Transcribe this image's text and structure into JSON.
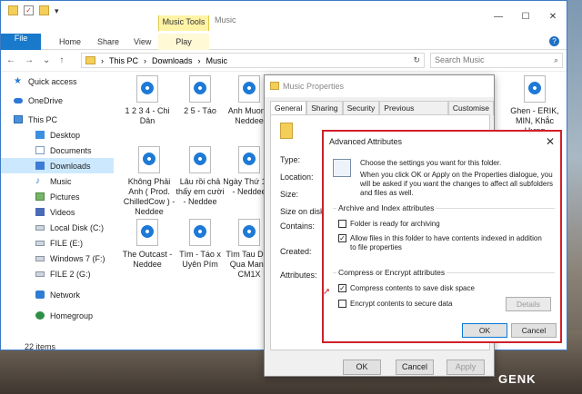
{
  "window": {
    "contextual_tab": "Music Tools",
    "title": "Music",
    "controls": {
      "minimize": "—",
      "maximize": "☐",
      "close": "✕"
    }
  },
  "ribbon": {
    "tabs": [
      "File",
      "Home",
      "Share",
      "View",
      "Play"
    ]
  },
  "address": {
    "path": [
      "This PC",
      "Downloads",
      "Music"
    ],
    "search_placeholder": "Search Music"
  },
  "sidebar": {
    "items": [
      {
        "label": "Quick access",
        "icon": "star-icon"
      },
      {
        "label": "OneDrive",
        "icon": "cloud-icon"
      },
      {
        "label": "This PC",
        "icon": "computer-icon"
      },
      {
        "label": "Desktop",
        "icon": "desktop-icon"
      },
      {
        "label": "Documents",
        "icon": "documents-icon"
      },
      {
        "label": "Downloads",
        "icon": "downloads-icon"
      },
      {
        "label": "Music",
        "icon": "music-icon"
      },
      {
        "label": "Pictures",
        "icon": "pictures-icon"
      },
      {
        "label": "Videos",
        "icon": "videos-icon"
      },
      {
        "label": "Local Disk (C:)",
        "icon": "drive-icon"
      },
      {
        "label": "FILE (E:)",
        "icon": "drive-icon"
      },
      {
        "label": "Windows 7 (F:)",
        "icon": "drive-icon"
      },
      {
        "label": "FILE 2 (G:)",
        "icon": "drive-icon"
      },
      {
        "label": "Network",
        "icon": "network-icon"
      },
      {
        "label": "Homegroup",
        "icon": "homegroup-icon"
      }
    ]
  },
  "files": [
    {
      "name": "1 2 3 4 - Chi Dân"
    },
    {
      "name": "2 5 - Táo"
    },
    {
      "name": "Anh Muon - Neddee"
    },
    {
      "name": "Ghen - ERIK, MIN, Khắc Hưng"
    },
    {
      "name": "Không Phải Anh ( Prod. ChilledCow ) - Neddee"
    },
    {
      "name": "Lâu rồi chả thấy em cười - Neddee"
    },
    {
      "name": "Ngày Thứ 175 - Neddee"
    },
    {
      "name": "The Outcast - Neddee"
    },
    {
      "name": "Tìm - Táo x Uyên Pím"
    },
    {
      "name": "Tìm Tau Dau Qua Man - CM1X"
    }
  ],
  "status": {
    "items": "22 items"
  },
  "properties": {
    "title": "Music Properties",
    "tabs": [
      "General",
      "Sharing",
      "Security",
      "Previous Versions",
      "Customise"
    ],
    "labels": [
      "Type:",
      "Location:",
      "Size:",
      "Size on disk:",
      "Contains:",
      "Created:",
      "Attributes:"
    ],
    "buttons": {
      "ok": "OK",
      "cancel": "Cancel",
      "apply": "Apply"
    }
  },
  "advanced": {
    "title": "Advanced Attributes",
    "close": "✕",
    "intro_line1": "Choose the settings you want for this folder.",
    "intro_line2": "When you click OK or Apply on the Properties dialogue, you will be asked if you want the changes to affect all subfolders and files as well.",
    "archive_group": "Archive and Index attributes",
    "archive_opt": "Folder is ready for archiving",
    "index_opt": "Allow files in this folder to have contents indexed in addition to file properties",
    "compress_group": "Compress or Encrypt attributes",
    "compress_opt": "Compress contents to save disk space",
    "encrypt_opt": "Encrypt contents to secure data",
    "details": "Details",
    "ok": "OK",
    "cancel": "Cancel",
    "checked": {
      "archive": false,
      "index": true,
      "compress": true,
      "encrypt": false
    }
  },
  "watermark": "GENK"
}
